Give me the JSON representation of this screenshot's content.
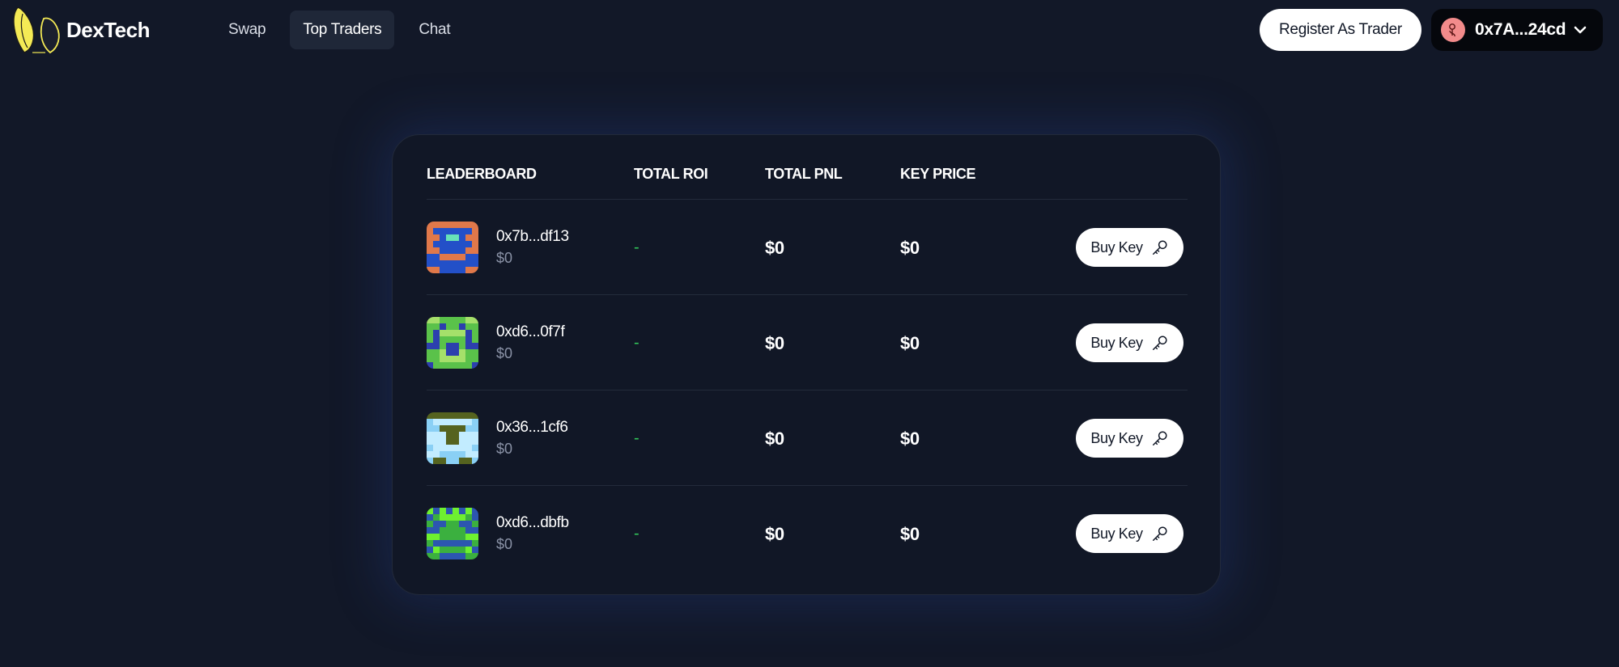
{
  "header": {
    "brand": "DexTech",
    "nav": [
      {
        "label": "Swap",
        "active": false
      },
      {
        "label": "Top Traders",
        "active": true
      },
      {
        "label": "Chat",
        "active": false
      }
    ],
    "register_label": "Register As Trader",
    "wallet": {
      "address": "0x7A...24cd",
      "icon": "user-avatar-icon"
    }
  },
  "leaderboard": {
    "headers": {
      "leaderboard": "LEADERBOARD",
      "total_roi": "TOTAL ROI",
      "total_pnl": "TOTAL PNL",
      "key_price": "KEY PRICE"
    },
    "rows": [
      {
        "name": "0x7b...df13",
        "sub": "$0",
        "roi": "-",
        "pnl": "$0",
        "key_price": "$0",
        "button": "Buy Key",
        "avatar_colors": [
          "#e0784a",
          "#2350c8",
          "#67e2b8"
        ]
      },
      {
        "name": "0xd6...0f7f",
        "sub": "$0",
        "roi": "-",
        "pnl": "$0",
        "key_price": "$0",
        "button": "Buy Key",
        "avatar_colors": [
          "#5ac24a",
          "#2c3fae",
          "#a5e06a"
        ]
      },
      {
        "name": "0x36...1cf6",
        "sub": "$0",
        "roi": "-",
        "pnl": "$0",
        "key_price": "$0",
        "button": "Buy Key",
        "avatar_colors": [
          "#8ad0f5",
          "#55631f",
          "#c2ecff"
        ]
      },
      {
        "name": "0xd6...dbfb",
        "sub": "$0",
        "roi": "-",
        "pnl": "$0",
        "key_price": "$0",
        "button": "Buy Key",
        "avatar_colors": [
          "#2c56b0",
          "#3bb03f",
          "#6ef030"
        ]
      }
    ]
  },
  "colors": {
    "background": "#121828",
    "panel": "#111726",
    "roi_green": "#32c85a",
    "logo_yellow": "#f4ea55",
    "muted_text": "#8b93a7"
  }
}
